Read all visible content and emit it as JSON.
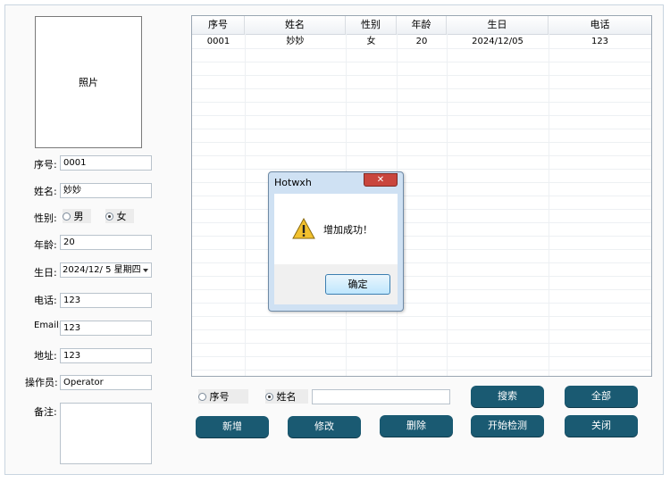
{
  "form": {
    "photo_label": "照片",
    "id_label": "序号:",
    "id_value": "0001",
    "name_label": "姓名:",
    "name_value": "妙妙",
    "gender_label": "性别:",
    "gender_male": "男",
    "gender_female": "女",
    "age_label": "年龄:",
    "age_value": "20",
    "birthday_label": "生日:",
    "birthday_value": "2024/12/ 5 星期四",
    "phone_label": "电话:",
    "phone_value": "123",
    "email_label": "Email:",
    "email_value": "123",
    "address_label": "地址:",
    "address_value": "123",
    "operator_label": "操作员:",
    "operator_value": "Operator",
    "note_label": "备注:"
  },
  "table": {
    "headers": [
      "序号",
      "姓名",
      "性别",
      "年龄",
      "生日",
      "电话"
    ],
    "rows": [
      [
        "0001",
        "妙妙",
        "女",
        "20",
        "2024/12/05",
        "123"
      ]
    ]
  },
  "search": {
    "by_id_label": "序号",
    "by_name_label": "姓名",
    "search_button": "搜索",
    "all_button": "全部"
  },
  "actions": {
    "add": "新增",
    "edit": "修改",
    "delete": "删除",
    "detect": "开始检测",
    "close": "关闭"
  },
  "dialog": {
    "title": "Hotwxh",
    "message": "增加成功！",
    "ok": "确定",
    "close_glyph": "✕"
  }
}
